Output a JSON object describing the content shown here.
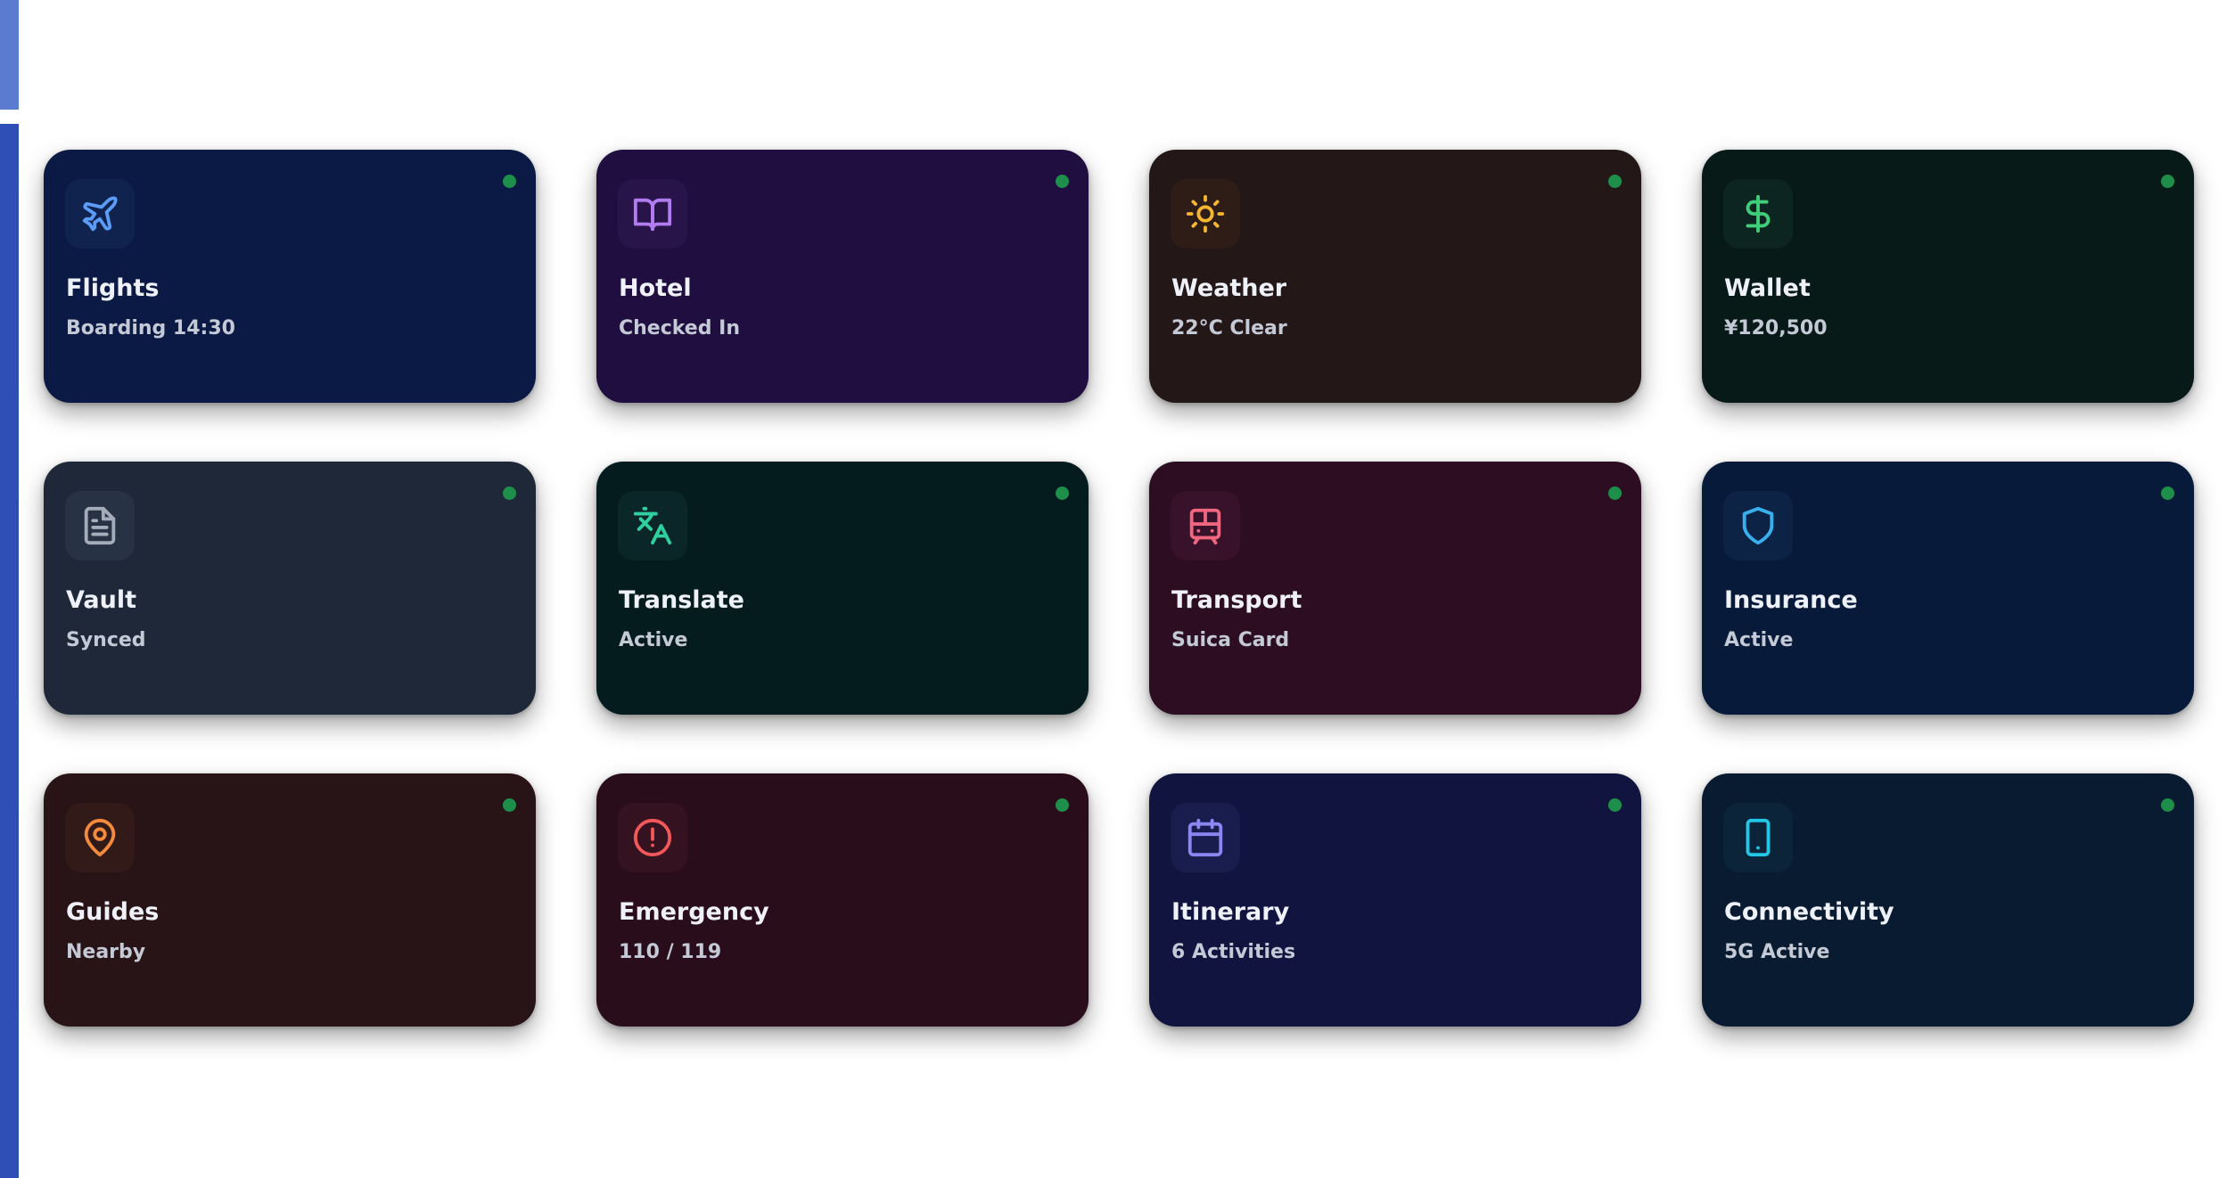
{
  "colors": {
    "status_dot": "#1e8f4a",
    "edge_top": "#5b7bd0",
    "edge_bottom": "#2f4fb6"
  },
  "cards": [
    {
      "title": "Flights",
      "subtitle": "Boarding 14:30",
      "icon": "plane-icon",
      "bg": "#0b1a45",
      "iconBg": "#10224e",
      "iconColor": "#5b9cf6"
    },
    {
      "title": "Hotel",
      "subtitle": "Checked In",
      "icon": "book-icon",
      "bg": "#1f0e3f",
      "iconBg": "#281449",
      "iconColor": "#b07cf0"
    },
    {
      "title": "Weather",
      "subtitle": "22°C Clear",
      "icon": "sun-icon",
      "bg": "#241717",
      "iconBg": "#2e1d16",
      "iconColor": "#f5b731"
    },
    {
      "title": "Wallet",
      "subtitle": "¥120,500",
      "icon": "dollar-icon",
      "bg": "#081a18",
      "iconBg": "#0d2520",
      "iconColor": "#3fcf7a"
    },
    {
      "title": "Vault",
      "subtitle": "Synced",
      "icon": "document-icon",
      "bg": "#1f2839",
      "iconBg": "#283245",
      "iconColor": "#a5acb9"
    },
    {
      "title": "Translate",
      "subtitle": "Active",
      "icon": "translate-icon",
      "bg": "#051c1e",
      "iconBg": "#0a2628",
      "iconColor": "#2fcfa0"
    },
    {
      "title": "Transport",
      "subtitle": "Suica Card",
      "icon": "train-icon",
      "bg": "#2c0d22",
      "iconBg": "#37122a",
      "iconColor": "#f0667f"
    },
    {
      "title": "Insurance",
      "subtitle": "Active",
      "icon": "shield-icon",
      "bg": "#081a3a",
      "iconBg": "#0c2346",
      "iconColor": "#38b0ee"
    },
    {
      "title": "Guides",
      "subtitle": "Nearby",
      "icon": "map-pin-icon",
      "bg": "#281316",
      "iconBg": "#321a18",
      "iconColor": "#f38a3c"
    },
    {
      "title": "Emergency",
      "subtitle": "110 / 119",
      "icon": "alert-icon",
      "bg": "#2a0d1a",
      "iconBg": "#35121f",
      "iconColor": "#f2585a"
    },
    {
      "title": "Itinerary",
      "subtitle": "6 Activities",
      "icon": "calendar-icon",
      "bg": "#10143f",
      "iconBg": "#181d4e",
      "iconColor": "#8a86f2"
    },
    {
      "title": "Connectivity",
      "subtitle": "5G Active",
      "icon": "phone-icon",
      "bg": "#081b30",
      "iconBg": "#0b243a",
      "iconColor": "#22c7e6"
    }
  ]
}
